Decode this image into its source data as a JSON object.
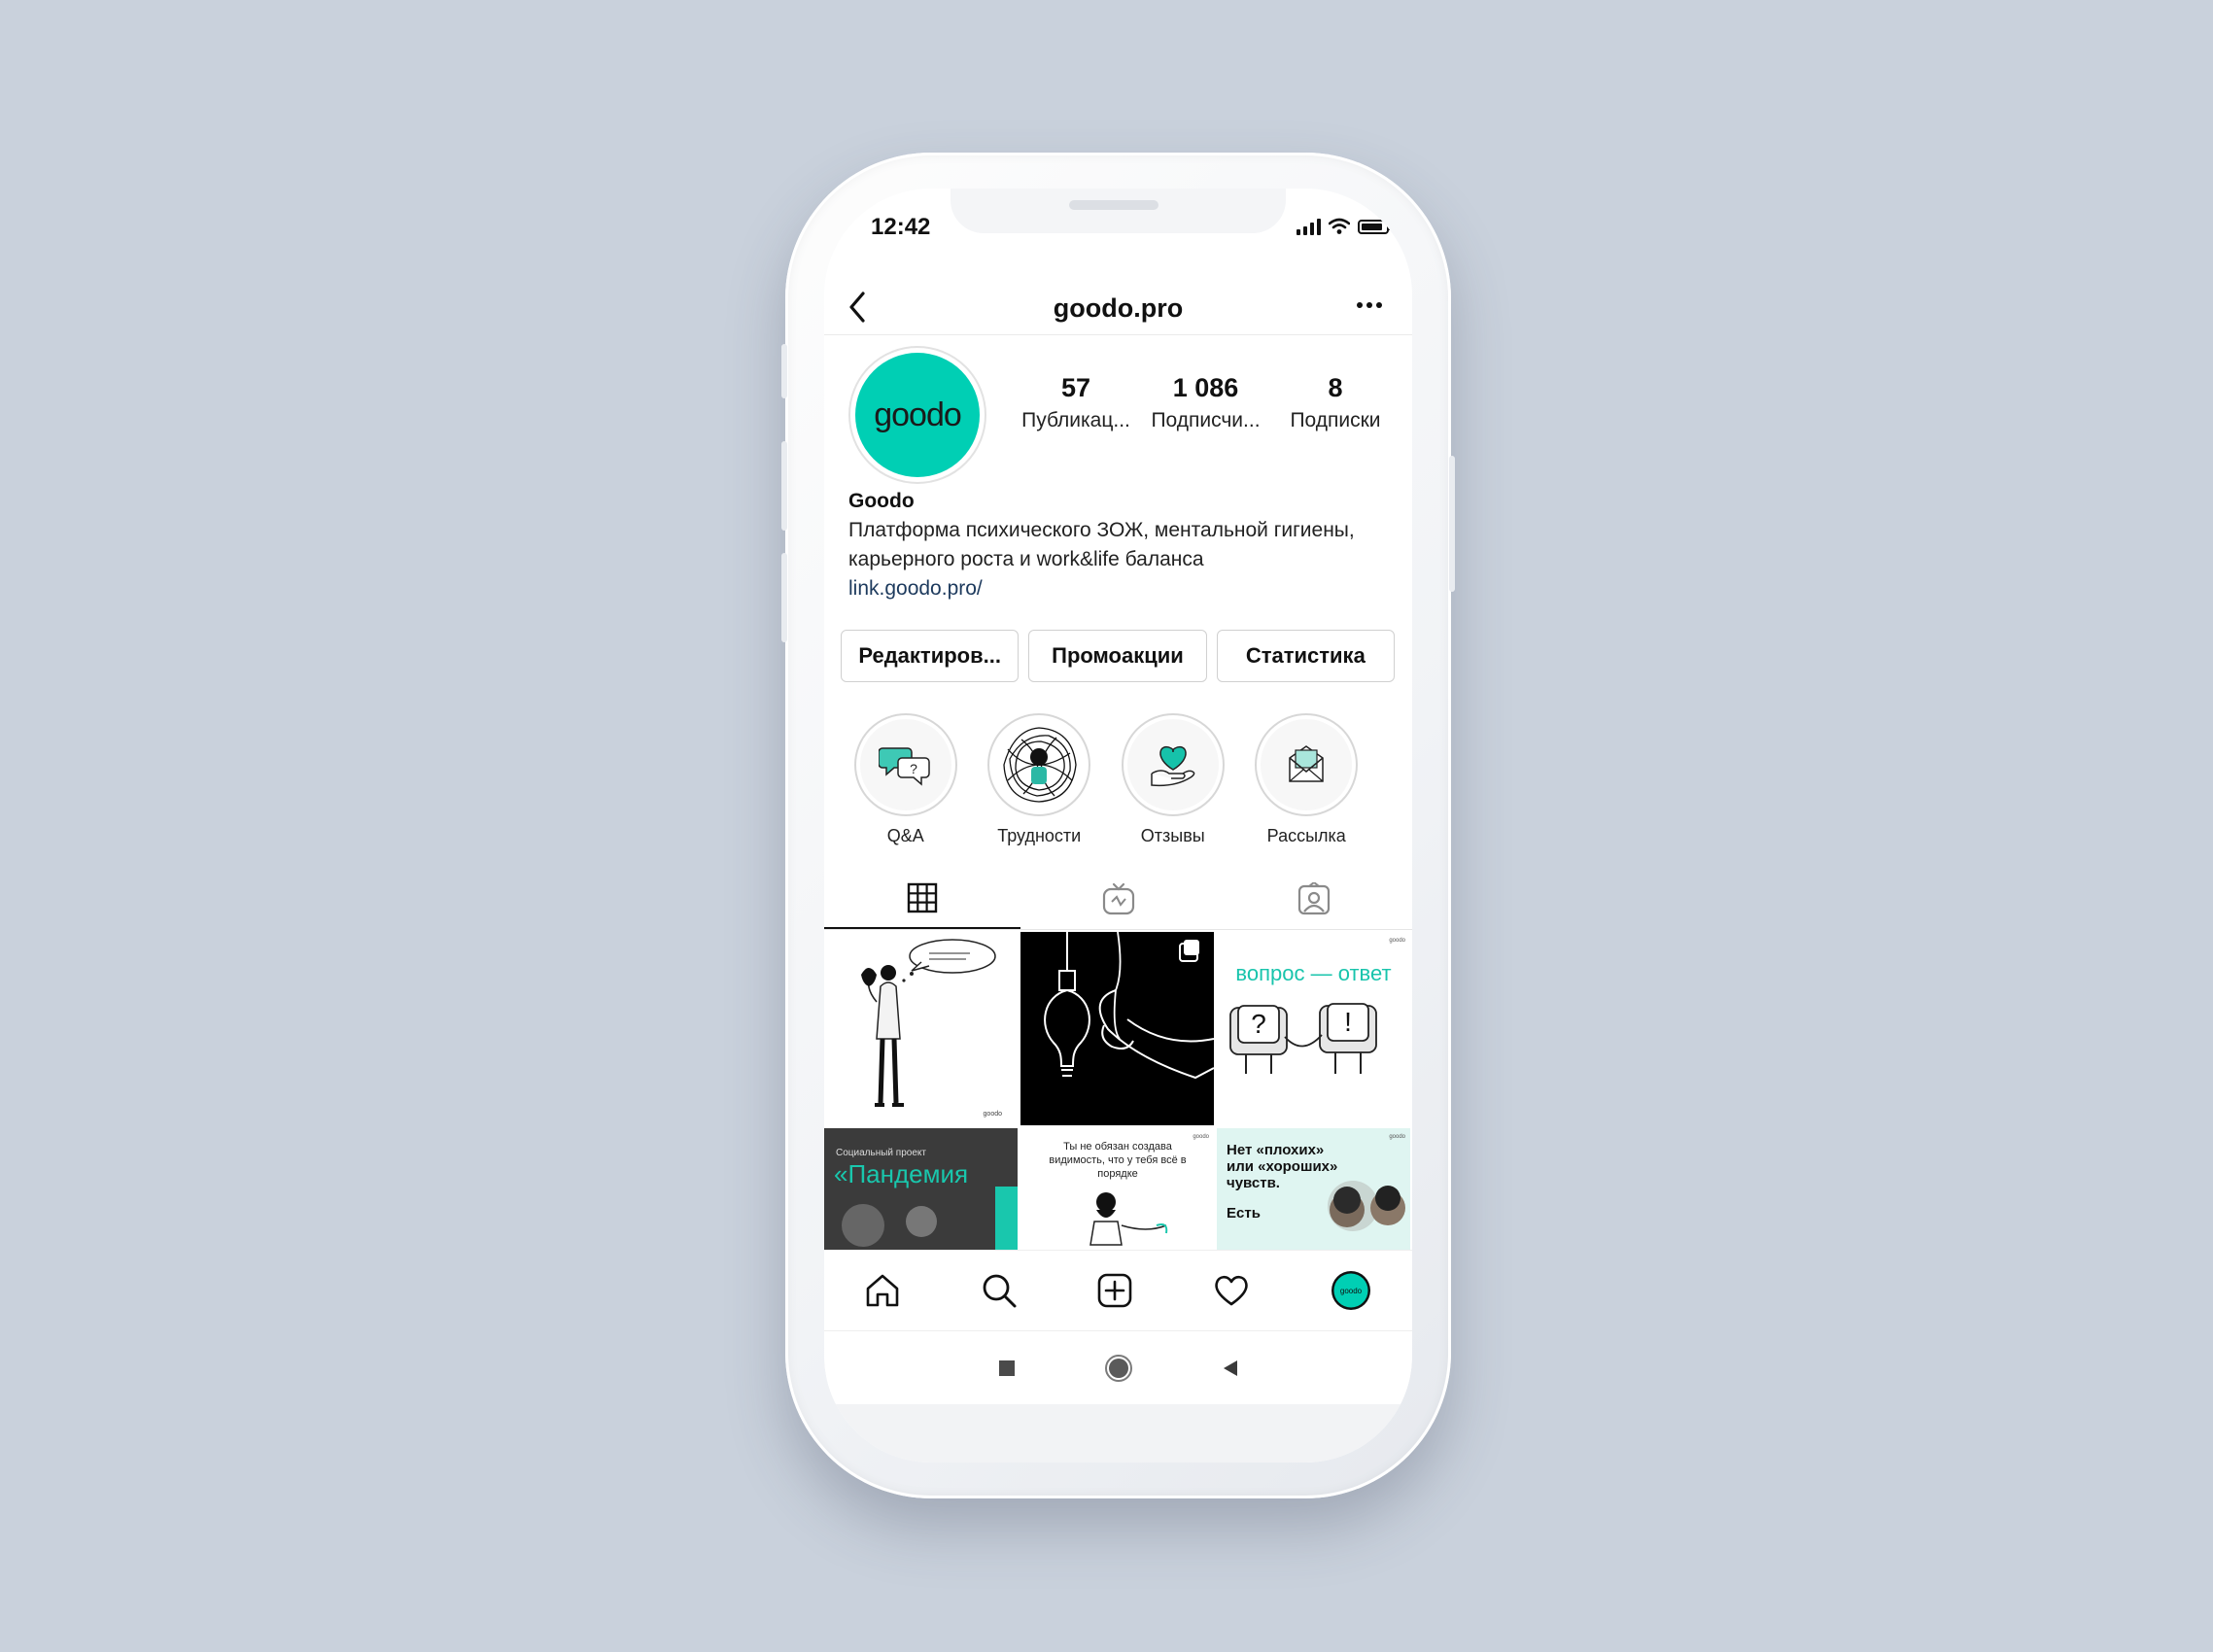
{
  "status_bar": {
    "time": "12:42"
  },
  "header": {
    "username": "goodo.pro",
    "back_icon": "chevron-left-icon",
    "more_icon": "more-horizontal-icon"
  },
  "profile": {
    "avatar_text": "goodo",
    "stats": [
      {
        "value": "57",
        "label": "Публикац..."
      },
      {
        "value": "1 086",
        "label": "Подписчи..."
      },
      {
        "value": "8",
        "label": "Подписки"
      }
    ],
    "name": "Goodo",
    "bio_line1": "Платформа психического ЗОЖ, ментальной гигиены,",
    "bio_line2": "карьерного роста и work&life баланса",
    "link": "link.goodo.pro/"
  },
  "actions": [
    {
      "label": "Редактиров..."
    },
    {
      "label": "Промоакции"
    },
    {
      "label": "Статистика"
    }
  ],
  "highlights": [
    {
      "label": "Q&A",
      "icon": "speech-bubbles-icon"
    },
    {
      "label": "Трудности",
      "icon": "tangled-person-icon"
    },
    {
      "label": "Отзывы",
      "icon": "heart-in-hand-icon"
    },
    {
      "label": "Рассылка",
      "icon": "envelope-icon"
    }
  ],
  "tabs": [
    {
      "icon": "grid-icon",
      "active": true
    },
    {
      "icon": "igtv-icon",
      "active": false
    },
    {
      "icon": "tagged-icon",
      "active": false
    }
  ],
  "posts": {
    "p3_text": "вопрос — ответ",
    "p4_small": "Социальный проект",
    "p4_title": "«Пандемия",
    "p5_text": "Ты не обязан создава видимость, что у тебя всё в порядке",
    "p6_text_1": "Нет «плохих»",
    "p6_text_2": "или «хороших»",
    "p6_text_3": "чувств.",
    "p6_text_4": "Есть",
    "watermark": "goodo"
  },
  "bottom_nav": [
    "home-icon",
    "search-icon",
    "add-post-icon",
    "activity-heart-icon",
    "profile-avatar-icon"
  ],
  "colors": {
    "accent": "#00cfb4",
    "background": "#c9d1dc",
    "text": "#111111",
    "link": "#1d3a5d"
  }
}
